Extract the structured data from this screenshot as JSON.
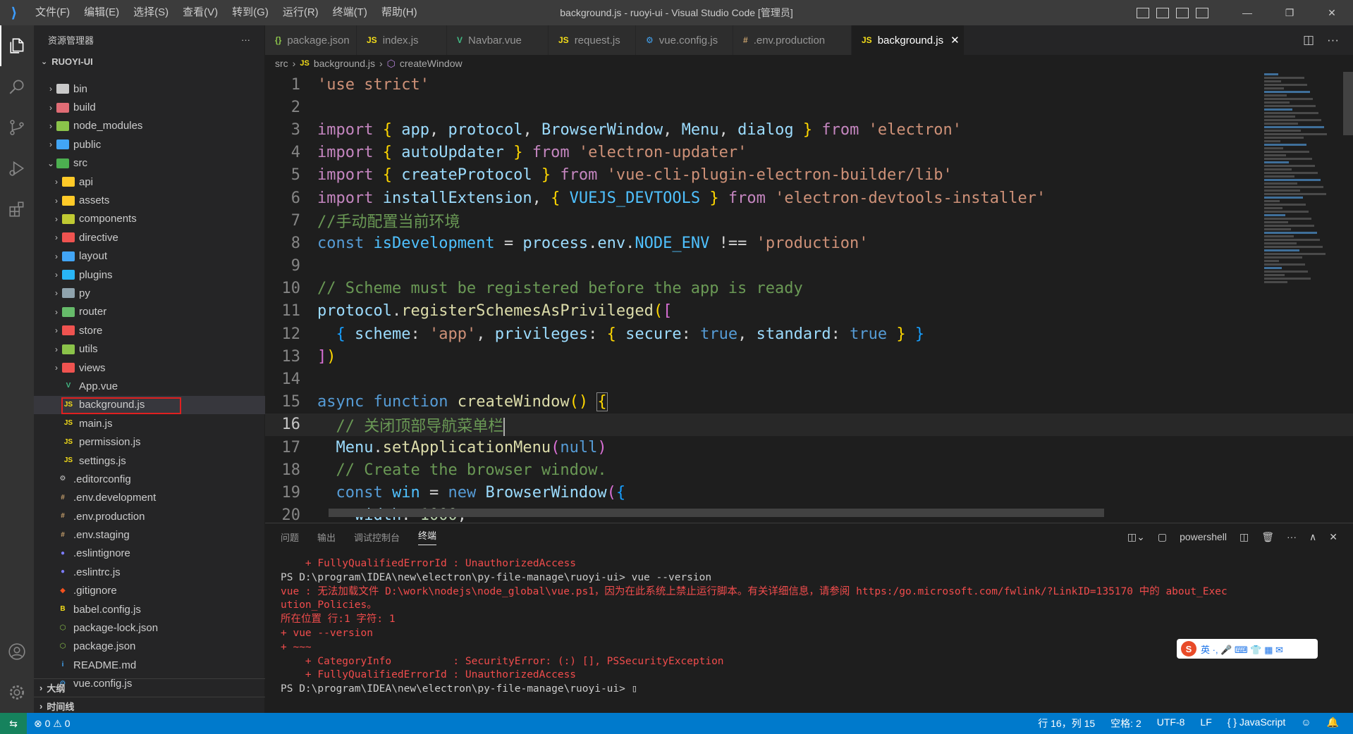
{
  "titlebar": {
    "logo": "VS",
    "menu": [
      "文件(F)",
      "编辑(E)",
      "选择(S)",
      "查看(V)",
      "转到(G)",
      "运行(R)",
      "终端(T)",
      "帮助(H)"
    ],
    "title": "background.js - ruoyi-ui - Visual Studio Code [管理员]",
    "min": "—",
    "max": "❐",
    "close": "✕"
  },
  "sidebar": {
    "title": "资源管理器",
    "more": "···",
    "project": "RUOYI-UI",
    "tree": [
      {
        "label": "bin",
        "indent": 1,
        "chev": "›",
        "color": "#c9c9c9"
      },
      {
        "label": "build",
        "indent": 1,
        "chev": "›",
        "color": "#e06c75"
      },
      {
        "label": "node_modules",
        "indent": 1,
        "chev": "›",
        "color": "#8bc34a"
      },
      {
        "label": "public",
        "indent": 1,
        "chev": "›",
        "color": "#42a5f5"
      },
      {
        "label": "src",
        "indent": 1,
        "chev": "⌄",
        "color": "#4caf50"
      },
      {
        "label": "api",
        "indent": 2,
        "chev": "›",
        "color": "#ffca28"
      },
      {
        "label": "assets",
        "indent": 2,
        "chev": "›",
        "color": "#ffca28"
      },
      {
        "label": "components",
        "indent": 2,
        "chev": "›",
        "color": "#c0ca33"
      },
      {
        "label": "directive",
        "indent": 2,
        "chev": "›",
        "color": "#ef5350"
      },
      {
        "label": "layout",
        "indent": 2,
        "chev": "›",
        "color": "#42a5f5"
      },
      {
        "label": "plugins",
        "indent": 2,
        "chev": "›",
        "color": "#29b6f6"
      },
      {
        "label": "py",
        "indent": 2,
        "chev": "›",
        "color": "#90a4ae"
      },
      {
        "label": "router",
        "indent": 2,
        "chev": "›",
        "color": "#66bb6a"
      },
      {
        "label": "store",
        "indent": 2,
        "chev": "›",
        "color": "#ef5350"
      },
      {
        "label": "utils",
        "indent": 2,
        "chev": "›",
        "color": "#8bc34a"
      },
      {
        "label": "views",
        "indent": 2,
        "chev": "›",
        "color": "#ef5350"
      },
      {
        "label": "App.vue",
        "indent": 2,
        "chev": "",
        "color": "#41b883",
        "file": "V"
      },
      {
        "label": "background.js",
        "indent": 2,
        "chev": "",
        "color": "#f5de19",
        "file": "JS",
        "selected": true
      },
      {
        "label": "main.js",
        "indent": 2,
        "chev": "",
        "color": "#f5de19",
        "file": "JS"
      },
      {
        "label": "permission.js",
        "indent": 2,
        "chev": "",
        "color": "#f5de19",
        "file": "JS"
      },
      {
        "label": "settings.js",
        "indent": 2,
        "chev": "",
        "color": "#f5de19",
        "file": "JS"
      },
      {
        "label": ".editorconfig",
        "indent": 1,
        "chev": "",
        "color": "#cccccc",
        "file": "⚙"
      },
      {
        "label": ".env.development",
        "indent": 1,
        "chev": "",
        "color": "#c9a26d",
        "file": "#"
      },
      {
        "label": ".env.production",
        "indent": 1,
        "chev": "",
        "color": "#c9a26d",
        "file": "#"
      },
      {
        "label": ".env.staging",
        "indent": 1,
        "chev": "",
        "color": "#c9a26d",
        "file": "#"
      },
      {
        "label": ".eslintignore",
        "indent": 1,
        "chev": "",
        "color": "#7c7cff",
        "file": "●"
      },
      {
        "label": ".eslintrc.js",
        "indent": 1,
        "chev": "",
        "color": "#7c7cff",
        "file": "●"
      },
      {
        "label": ".gitignore",
        "indent": 1,
        "chev": "",
        "color": "#f4511e",
        "file": "◆"
      },
      {
        "label": "babel.config.js",
        "indent": 1,
        "chev": "",
        "color": "#f5de19",
        "file": "B"
      },
      {
        "label": "package-lock.json",
        "indent": 1,
        "chev": "",
        "color": "#8bc34a",
        "file": "⬡"
      },
      {
        "label": "package.json",
        "indent": 1,
        "chev": "",
        "color": "#8bc34a",
        "file": "⬡"
      },
      {
        "label": "README.md",
        "indent": 1,
        "chev": "",
        "color": "#42a5f5",
        "file": "i"
      },
      {
        "label": "vue.config.js",
        "indent": 1,
        "chev": "",
        "color": "#42a5f5",
        "file": "⚙"
      }
    ],
    "outline": "大纲",
    "timeline": "时间线"
  },
  "tabs": [
    {
      "label": "package.json",
      "icon": "{}",
      "color": "#8bc34a"
    },
    {
      "label": "index.js",
      "icon": "JS",
      "color": "#f5de19"
    },
    {
      "label": "Navbar.vue",
      "icon": "V",
      "color": "#41b883"
    },
    {
      "label": "request.js",
      "icon": "JS",
      "color": "#f5de19"
    },
    {
      "label": "vue.config.js",
      "icon": "⚙",
      "color": "#42a5f5"
    },
    {
      "label": ".env.production",
      "icon": "#",
      "color": "#c9a26d"
    },
    {
      "label": "background.js",
      "icon": "JS",
      "color": "#f5de19",
      "active": true
    }
  ],
  "breadcrumb": {
    "a": "src",
    "b": "background.js",
    "c": "createWindow"
  },
  "editor": {
    "current_line": 16
  },
  "panel": {
    "tabs": [
      "问题",
      "输出",
      "调试控制台",
      "终端"
    ],
    "active_tab": "终端",
    "shell": "powershell",
    "terminal": [
      {
        "text": "    + FullyQualifiedErrorId : UnauthorizedAccess",
        "cls": "t-red"
      },
      {
        "text": "PS D:\\program\\IDEA\\new\\electron\\py-file-manage\\ruoyi-ui> vue --version",
        "cls": "t-white"
      },
      {
        "text": "vue : 无法加载文件 D:\\work\\nodejs\\node_global\\vue.ps1，因为在此系统上禁止运行脚本。有关详细信息，请参阅 https:/go.microsoft.com/fwlink/?LinkID=135170 中的 about_Exec",
        "cls": "t-red"
      },
      {
        "text": "ution_Policies。",
        "cls": "t-red"
      },
      {
        "text": "所在位置 行:1 字符: 1",
        "cls": "t-red"
      },
      {
        "text": "+ vue --version",
        "cls": "t-red"
      },
      {
        "text": "+ ~~~",
        "cls": "t-red"
      },
      {
        "text": "    + CategoryInfo          : SecurityError: (:) [], PSSecurityException",
        "cls": "t-red"
      },
      {
        "text": "    + FullyQualifiedErrorId : UnauthorizedAccess",
        "cls": "t-red"
      },
      {
        "text": "PS D:\\program\\IDEA\\new\\electron\\py-file-manage\\ruoyi-ui> ▯",
        "cls": "t-white"
      }
    ],
    "ime": "英 ·, 🎤 ⌨ 👕 ▦ ✉"
  },
  "statusbar": {
    "remote": "⇆",
    "problems": "⊗ 0 ⚠ 0",
    "position": "行 16，列 15",
    "spaces": "空格: 2",
    "encoding": "UTF-8",
    "eol": "LF",
    "language": "{ } JavaScript",
    "feedback": "☺",
    "bell": "🔔"
  },
  "colors": {
    "accent": "#007acc",
    "selection_box": "#e02020"
  }
}
